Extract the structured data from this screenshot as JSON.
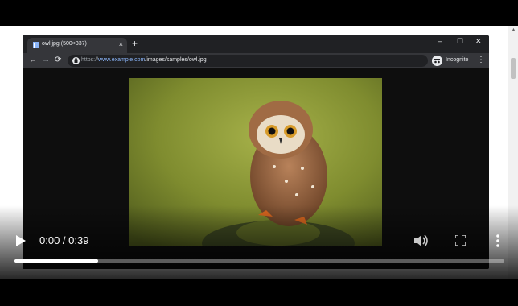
{
  "browser": {
    "tab_title": "owl.jpg (500×337)",
    "tab_close": "×",
    "new_tab": "+",
    "window_controls": {
      "minimize": "–",
      "maximize": "☐",
      "close": "✕"
    },
    "nav": {
      "back": "←",
      "forward": "→",
      "reload": "⟳"
    },
    "url": {
      "scheme": "https://",
      "host": "www.example.com",
      "path": "/images/samples/owl.jpg"
    },
    "incognito_label": "Incognito",
    "menu": "⋮"
  },
  "image": {
    "alt": "owl"
  },
  "player": {
    "time": "0:00 / 0:39",
    "progress_fraction": 0.17,
    "icons": {
      "play": "play-icon",
      "volume": "volume-icon",
      "fullscreen": "fullscreen-icon",
      "more": "more-vert-icon"
    }
  },
  "colors": {
    "accent": "#8ab4f8",
    "chrome_bg": "#202124",
    "toolbar_bg": "#35363a"
  }
}
